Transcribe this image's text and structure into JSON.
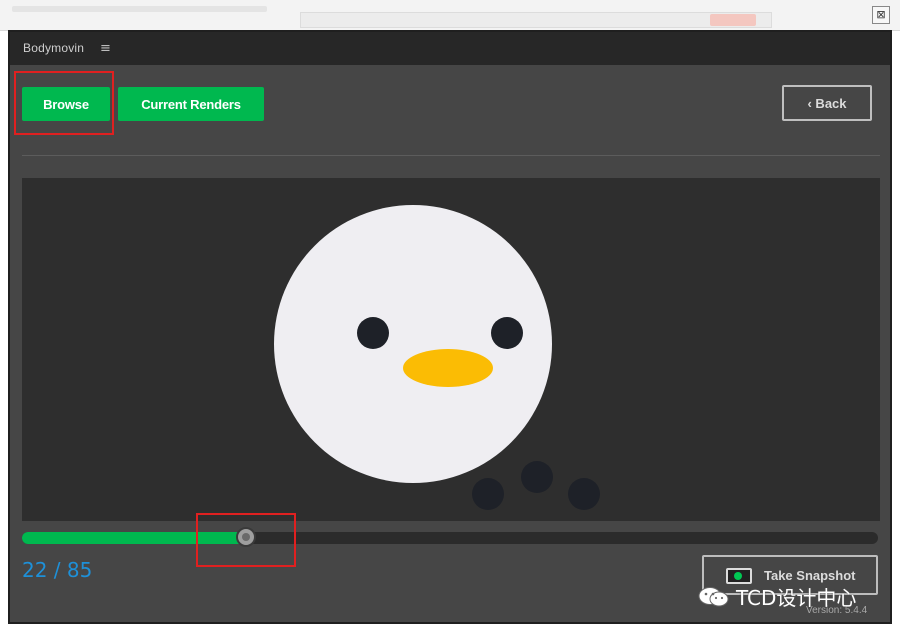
{
  "app": {
    "title": "Bodymovin",
    "menu_icon": "hamburger-menu-icon"
  },
  "toolbar": {
    "browse_label": "Browse",
    "current_renders_label": "Current Renders",
    "back_label": "‹ Back"
  },
  "preview": {
    "current_frame": 22,
    "total_frames": 85,
    "frame_counter": "22 / 85",
    "progress_fraction": 0.262
  },
  "snapshot": {
    "label": "Take Snapshot",
    "icon": "camera-icon"
  },
  "version": "Version: 5.4.4",
  "watermark": {
    "text": "TCD设计中心",
    "icon": "wechat-icon"
  },
  "colors": {
    "accent_green": "#00b84f",
    "frame_counter_blue": "#1e90d8",
    "highlight_red": "#e02020",
    "beak_yellow": "#fbbc04",
    "face_white": "#efeef2",
    "dark_dots": "#1e2128"
  }
}
